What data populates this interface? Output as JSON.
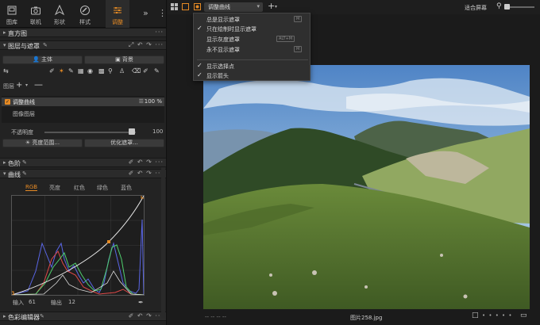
{
  "tabs": [
    {
      "label": "图库",
      "icon": "library-icon"
    },
    {
      "label": "联机",
      "icon": "camera-icon"
    },
    {
      "label": "形状",
      "icon": "shape-icon"
    },
    {
      "label": "样式",
      "icon": "style-icon"
    },
    {
      "label": "调整",
      "icon": "adjust-icon"
    }
  ],
  "sections": {
    "histogram": "直方图",
    "layers_masks": "图层与遮罩",
    "levels": "色阶",
    "curves": "曲线",
    "color_editor": "色彩编辑器"
  },
  "buttons": {
    "subject": "主体",
    "background": "背景",
    "brightness_range": "亮度范围...",
    "refine_mask": "优化遮罩..."
  },
  "layers": {
    "header": "图层",
    "items": [
      {
        "name": "调整曲线",
        "opacity": "100 %",
        "selected": true
      },
      {
        "name": "图像图层",
        "selected": false
      }
    ],
    "opacity_label": "不透明度",
    "opacity_value": "100"
  },
  "curves": {
    "channels": [
      "RGB",
      "亮度",
      "红色",
      "绿色",
      "蓝色"
    ],
    "active_channel": "RGB",
    "input_label": "输入",
    "input_value": "61",
    "output_label": "输出",
    "output_value": "12"
  },
  "topbar": {
    "layer_select": "调整曲线",
    "fit_label": "适合屏幕"
  },
  "menu": {
    "items": [
      {
        "label": "总是显示遮罩",
        "checked": false,
        "shortcut": "M"
      },
      {
        "label": "只在绘制时显示遮罩",
        "checked": true,
        "shortcut": ""
      },
      {
        "label": "显示灰度遮罩",
        "checked": false,
        "shortcut": "ALT+M"
      },
      {
        "label": "永不显示遮罩",
        "checked": false,
        "shortcut": "M"
      },
      {
        "label": "显示选择点",
        "checked": true,
        "shortcut": ""
      },
      {
        "label": "显示箭头",
        "checked": true,
        "shortcut": ""
      }
    ]
  },
  "viewer": {
    "file_name": "图片258.jpg",
    "left_info": "--    --    --    --"
  },
  "colors": {
    "accent": "#e58a24",
    "panel": "#232323",
    "background": "#1b1b1b"
  }
}
